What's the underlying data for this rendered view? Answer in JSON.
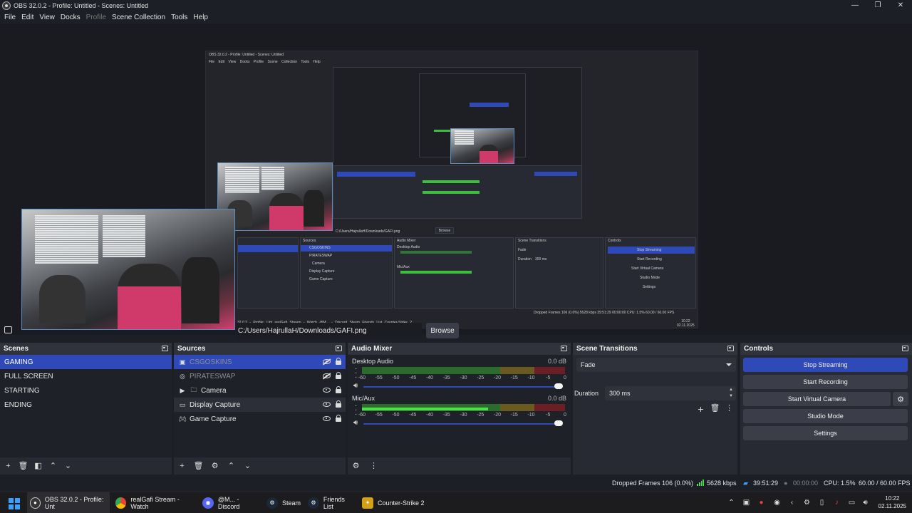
{
  "window": {
    "title": "OBS 32.0.2 - Profile: Untitled - Scenes: Untitled",
    "controls": [
      "—",
      "❐",
      "✕"
    ]
  },
  "menu": [
    "File",
    "Edit",
    "View",
    "Docks",
    "Profile",
    "Scene Collection",
    "Tools",
    "Help"
  ],
  "preview": {
    "nested_title": "OBS 32.0.2 - Profile: Untitled - Scenes: Untitled",
    "nested_menu": [
      "File",
      "Edit",
      "View",
      "Docks",
      "Profile",
      "Scene Collection",
      "Tools",
      "Help"
    ],
    "nested_path": "C:/Users/HajrullaH/Downloads/GAFI.png",
    "nested_browse": "Browse",
    "nested_sources_header": "Sources",
    "nested_mixer_header": "Audio Mixer",
    "nested_transitions_header": "Scene Transitions",
    "nested_controls_header": "Controls",
    "nested_sources": [
      "CSGOSKINS",
      "PIRATESWAP",
      "Camera",
      "Display Capture",
      "Game Capture"
    ],
    "nested_mixer": [
      "Desktop Audio",
      "Mic/Aux"
    ],
    "nested_controls": [
      "Stop Streaming",
      "Start Recording",
      "Start Virtual Camera",
      "Studio Mode",
      "Settings"
    ],
    "nested_transition": "Fade",
    "nested_duration_label": "Duration",
    "nested_duration": "300 ms",
    "nested_status": "Dropped Frames 106 (0.0%)   5628 kbps   39:51:29   00:00:00   CPU: 1.5%   60.00 / 60.00 FPS",
    "nested_taskbar": [
      "32.0.2 - Profile: Unt",
      "realGafi Stream - Watch",
      "@M... - Discord",
      "Steam",
      "Friends List",
      "Counter-Strike 2"
    ],
    "nested_clock_time": "10:22",
    "nested_clock_date": "02.11.2025"
  },
  "properties": {
    "path": "C:/Users/HajrullaH/Downloads/GAFI.png",
    "browse": "Browse"
  },
  "scenes": {
    "title": "Scenes",
    "items": [
      "GAMING",
      "FULL SCREEN",
      "STARTING",
      "ENDING"
    ],
    "selected": 0
  },
  "sources": {
    "title": "Sources",
    "items": [
      {
        "name": "CSGOSKINS",
        "icon": "image-icon",
        "visible": false,
        "state": "selected"
      },
      {
        "name": "PIRATESWAP",
        "icon": "browser-icon",
        "visible": false,
        "state": "dim"
      },
      {
        "name": "Camera",
        "icon": "folder-icon",
        "visible": true,
        "state": "normal"
      },
      {
        "name": "Display Capture",
        "icon": "monitor-icon",
        "visible": true,
        "state": "hovered"
      },
      {
        "name": "Game Capture",
        "icon": "gamepad-icon",
        "visible": true,
        "state": "normal"
      }
    ]
  },
  "mixer": {
    "title": "Audio Mixer",
    "channels": [
      {
        "name": "Desktop Audio",
        "db": "0.0 dB",
        "level": 0,
        "volume": 1.0
      },
      {
        "name": "Mic/Aux",
        "db": "0.0 dB",
        "level": 0.62,
        "volume": 1.0
      }
    ],
    "ticks": [
      "-60",
      "-55",
      "-50",
      "-45",
      "-40",
      "-35",
      "-30",
      "-25",
      "-20",
      "-15",
      "-10",
      "-5",
      "0"
    ]
  },
  "transitions": {
    "title": "Scene Transitions",
    "selected": "Fade",
    "duration_label": "Duration",
    "duration": "300 ms"
  },
  "controls": {
    "title": "Controls",
    "stop_streaming": "Stop Streaming",
    "start_recording": "Start Recording",
    "start_virtual_camera": "Start Virtual Camera",
    "studio_mode": "Studio Mode",
    "settings": "Settings"
  },
  "status": {
    "dropped_frames": "Dropped Frames 106 (0.0%)",
    "bitrate": "5628 kbps",
    "stream_time": "39:51:29",
    "record_time": "00:00:00",
    "cpu": "CPU: 1.5%",
    "fps": "60.00 / 60.00 FPS"
  },
  "taskbar": {
    "apps": [
      {
        "label": "OBS 32.0.2 - Profile: Unt",
        "active": true
      },
      {
        "label": "realGafi Stream - Watch",
        "active": false
      },
      {
        "label": "@M... - Discord",
        "active": false,
        "badge": "9+"
      },
      {
        "label": "Steam",
        "active": false
      },
      {
        "label": "Friends List",
        "active": false
      },
      {
        "label": "Counter-Strike 2",
        "active": false
      }
    ],
    "time": "10:22",
    "date": "02.11.2025"
  },
  "colors": {
    "accent": "#2f4ab8",
    "meter_green": "#4be04b",
    "background": "#1d1f26"
  }
}
